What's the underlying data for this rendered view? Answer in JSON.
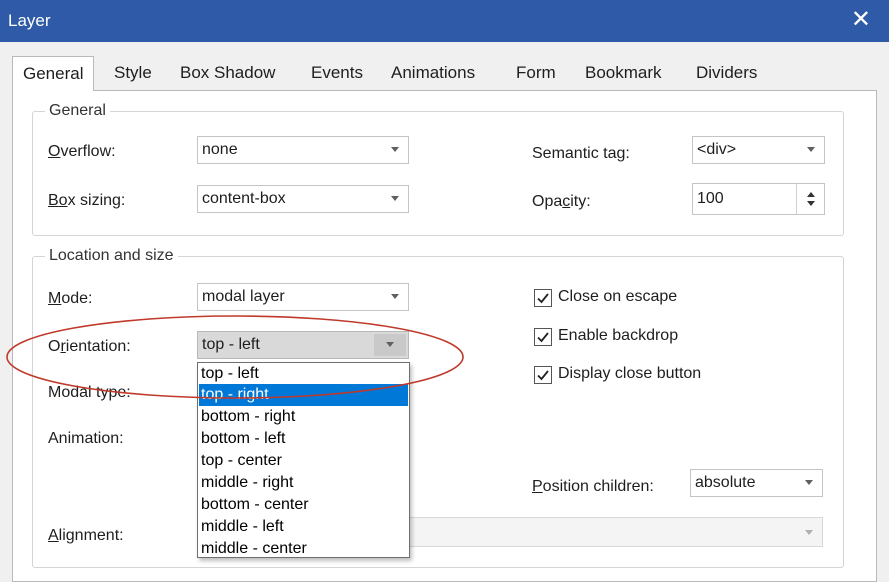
{
  "window": {
    "title": "Layer",
    "close_glyph": "✕"
  },
  "tabs": [
    {
      "label": "General",
      "active": true
    },
    {
      "label": "Style"
    },
    {
      "label": "Box Shadow"
    },
    {
      "label": "Events"
    },
    {
      "label": "Animations"
    },
    {
      "label": "Form"
    },
    {
      "label": "Bookmark"
    },
    {
      "label": "Dividers"
    }
  ],
  "general": {
    "title": "General",
    "overflow_label_u": "O",
    "overflow_label_rest": "verflow:",
    "overflow_value": "none",
    "box_sizing_label_pre": "B",
    "box_sizing_label_u": "o",
    "box_sizing_label_rest": "x sizing:",
    "box_sizing_value": "content-box",
    "semantic_tag_label": "Semantic tag:",
    "semantic_tag_value": "<div>",
    "opacity_label_pre": "Opa",
    "opacity_label_u": "c",
    "opacity_label_rest": "ity:",
    "opacity_value": "100"
  },
  "location": {
    "title": "Location and size",
    "mode_label_u": "M",
    "mode_label_rest": "ode:",
    "mode_value": "modal layer",
    "orientation_label_pre": "O",
    "orientation_label_u": "r",
    "orientation_label_rest": "ientation:",
    "orientation_value": "top - left",
    "modal_type_label": "Modal type:",
    "animation_label": "Animation:",
    "alignment_label_u": "A",
    "alignment_label_rest": "lignment:",
    "position_children_label_u": "P",
    "position_children_label_rest": "osition children:",
    "position_children_value": "absolute",
    "close_on_escape": "Close on escape",
    "enable_backdrop": "Enable backdrop",
    "display_close_button": "Display close button"
  },
  "orientation_options": [
    "top - left",
    "top - right",
    "bottom - right",
    "bottom - left",
    "top - center",
    "middle - right",
    "bottom - center",
    "middle - left",
    "middle - center"
  ],
  "colors": {
    "titlebar": "#2f5aa8",
    "highlight": "#0078d7",
    "annotation": "#c0392b"
  }
}
